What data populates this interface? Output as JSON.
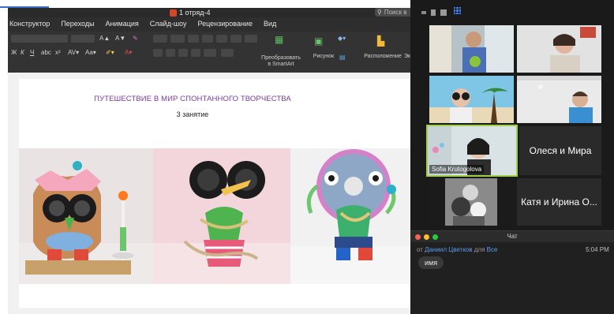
{
  "ppt": {
    "doc_title": "1 отряд-4",
    "search_placeholder": "Поиск в",
    "menu": [
      "Конструктор",
      "Переходы",
      "Анимация",
      "Слайд-шоу",
      "Рецензирование",
      "Вид"
    ],
    "ribbon": {
      "smartart_line1": "Преобразовать",
      "smartart_line2": "в SmartArt",
      "picture": "Рисунок",
      "arrange": "Расположение",
      "font_tools": [
        "A▲",
        "A▼",
        "Aa▾",
        "A▾"
      ],
      "clipped_label": "Эк"
    },
    "slide": {
      "title": "ПУТЕШЕСТВИЕ В МИР СПОНТАННОГО ТВОРЧЕСТВА",
      "subtitle": "3 занятие"
    }
  },
  "zoom": {
    "participants": [
      {
        "type": "video"
      },
      {
        "type": "video"
      },
      {
        "type": "video"
      },
      {
        "type": "video"
      },
      {
        "type": "video",
        "label": "Sofia Krutogolova",
        "active": true
      },
      {
        "type": "name",
        "name": "Олеся и Мира"
      },
      {
        "type": "video"
      },
      {
        "type": "name",
        "name": "Катя и Ирина О..."
      }
    ]
  },
  "chat": {
    "title": "Чат",
    "from_prefix": "от",
    "sender": "Даниил Цветков",
    "to_prefix": "для",
    "recipient": "Все",
    "time": "5:04 PM",
    "message": "имя"
  },
  "colors": {
    "slide_title": "#7c3aa8",
    "zoom_active_border": "#9fcf4a",
    "chat_sender": "#5b9cf0",
    "dot_close": "#ff5f57",
    "dot_min": "#febc2e",
    "dot_max": "#28c840"
  }
}
